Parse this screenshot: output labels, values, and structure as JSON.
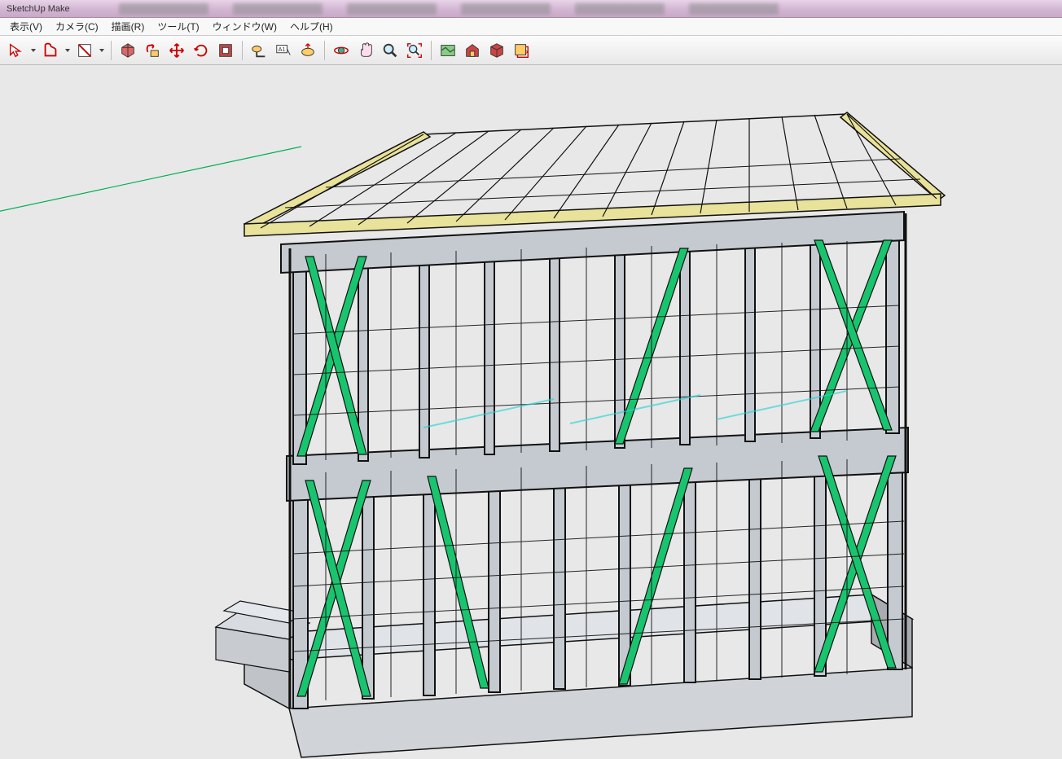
{
  "app": {
    "title": "SketchUp Make"
  },
  "menu": {
    "items": [
      "表示(V)",
      "カメラ(C)",
      "描画(R)",
      "ツール(T)",
      "ウィンドウ(W)",
      "ヘルプ(H)"
    ]
  },
  "toolbar": {
    "icons": [
      "select-icon",
      "shapes-icon",
      "paint-bucket-icon",
      "face-style-icon",
      "push-pull-icon",
      "move-icon",
      "rotate-icon",
      "scale-icon",
      "offset-icon",
      "tape-measure-icon",
      "label-icon",
      "protractor-icon",
      "orbit-icon",
      "pan-icon",
      "zoom-icon",
      "zoom-extents-icon",
      "map-icon",
      "warehouse-icon",
      "components-icon",
      "layers-icon"
    ]
  },
  "colors": {
    "axis_green": "#00b050",
    "brace_green": "#19c46e",
    "lumber_yellow": "#e8e29a",
    "steel_grey": "#b8c0c8",
    "line": "#111"
  }
}
